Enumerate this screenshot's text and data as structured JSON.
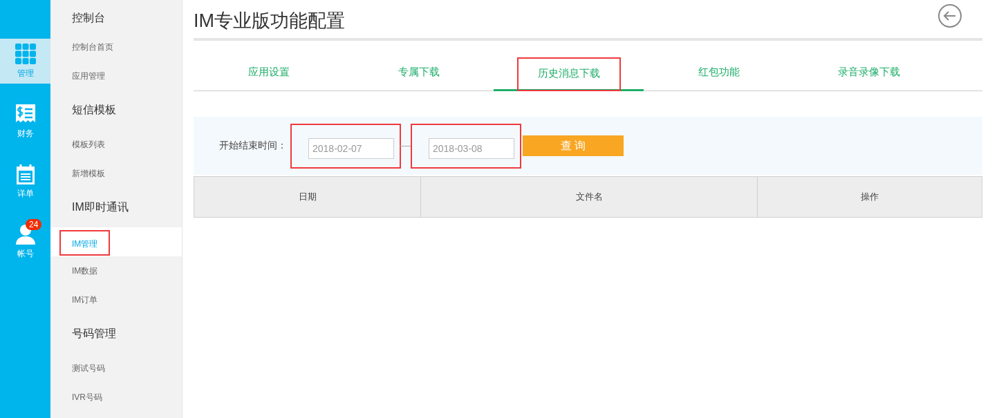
{
  "rail": [
    {
      "label": "管理",
      "kind": "grid",
      "selected": true
    },
    {
      "label": "财务",
      "kind": "receipt",
      "selected": false
    },
    {
      "label": "详单",
      "kind": "calendar",
      "selected": false
    },
    {
      "label": "帐号",
      "kind": "person",
      "selected": false,
      "badge": "24"
    }
  ],
  "sidebar": {
    "groups": [
      {
        "title": "控制台",
        "items": [
          {
            "label": "控制台首页",
            "selected": false,
            "highlighted": false
          },
          {
            "label": "应用管理",
            "selected": false,
            "highlighted": false
          }
        ]
      },
      {
        "title": "短信模板",
        "items": [
          {
            "label": "模板列表",
            "selected": false,
            "highlighted": false
          },
          {
            "label": "新增模板",
            "selected": false,
            "highlighted": false
          }
        ]
      },
      {
        "title": "IM即时通讯",
        "items": [
          {
            "label": "IM管理",
            "selected": true,
            "highlighted": true
          },
          {
            "label": "IM数据",
            "selected": false,
            "highlighted": false
          },
          {
            "label": "IM订单",
            "selected": false,
            "highlighted": false
          }
        ]
      },
      {
        "title": "号码管理",
        "items": [
          {
            "label": "测试号码",
            "selected": false,
            "highlighted": false
          },
          {
            "label": "IVR号码",
            "selected": false,
            "highlighted": false
          }
        ]
      }
    ]
  },
  "page": {
    "title": "IM专业版功能配置"
  },
  "tabs": [
    {
      "label": "应用设置",
      "selected": false,
      "highlighted": false
    },
    {
      "label": "专属下载",
      "selected": false,
      "highlighted": false
    },
    {
      "label": "历史消息下载",
      "selected": true,
      "highlighted": true
    },
    {
      "label": "红包功能",
      "selected": false,
      "highlighted": false
    },
    {
      "label": "录音录像下载",
      "selected": false,
      "highlighted": false
    }
  ],
  "filter": {
    "label": "开始结束时间：",
    "start": {
      "value": "2018-02-07",
      "highlighted": true
    },
    "end": {
      "value": "2018-03-08",
      "highlighted": true
    },
    "button": "查 询"
  },
  "table": {
    "columns": [
      "日期",
      "文件名",
      "操作"
    ]
  }
}
